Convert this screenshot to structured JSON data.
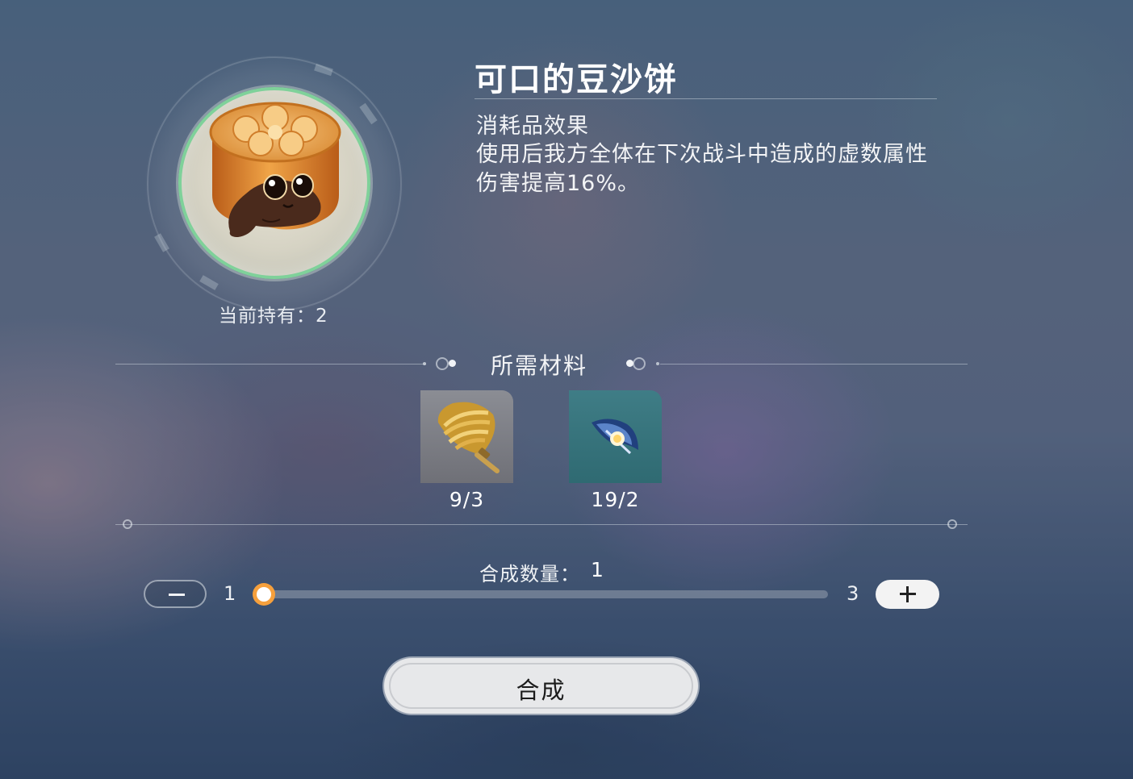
{
  "item": {
    "name": "可口的豆沙饼",
    "icon": "mooncake-cat-icon",
    "held_label": "当前持有：",
    "held_count": "2",
    "effect_heading": "消耗品效果",
    "effect_text": "使用后我方全体在下次战斗中造成的虚数属性伤害提高16%。"
  },
  "materials": {
    "title": "所需材料",
    "items": [
      {
        "icon": "grain-bundle-icon",
        "count": "9/3"
      },
      {
        "icon": "blue-feather-icon",
        "count": "19/2"
      }
    ]
  },
  "quantity": {
    "label": "合成数量：",
    "value": "1",
    "min": "1",
    "max": "3",
    "level": 0
  },
  "actions": {
    "craft_label": "合成"
  },
  "colors": {
    "orb_ring": "#7fd19a",
    "slider_knob": "#f6a03c",
    "craft_button": "#e7e8ea"
  }
}
